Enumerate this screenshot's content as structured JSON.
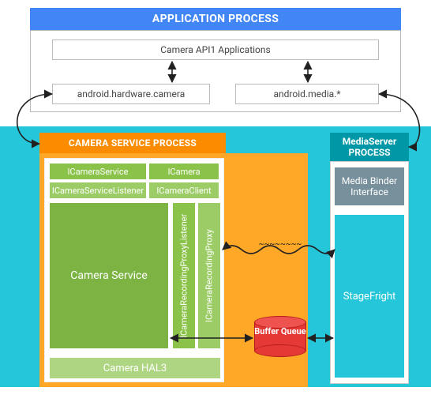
{
  "app": {
    "header": "APPLICATION PROCESS",
    "api": "Camera API1 Applications",
    "hal_camera": "android.hardware.camera",
    "media_ns": "android.media.*"
  },
  "csp": {
    "header": "CAMERA SERVICE PROCESS",
    "svc_iface": "ICameraService",
    "cam_iface": "ICamera",
    "svc_listener": "ICameraServiceListener",
    "cam_client": "ICameraClient",
    "rec_proxy_listener": "ICameraRecordingProxyListener",
    "rec_proxy": "ICameraRecordingProxy",
    "service": "Camera Service",
    "hal3": "Camera HAL3"
  },
  "msp": {
    "header": "MediaServer PROCESS",
    "binder": "Media Binder Interface",
    "stagefright": "StageFright"
  },
  "bufq": "Buffer Queue",
  "chart_data": {
    "type": "diagram",
    "title": "Android Camera Architecture (API1 path)",
    "nodes": [
      {
        "id": "app_process",
        "label": "APPLICATION PROCESS",
        "children": [
          "api1",
          "hw_camera",
          "media_ns"
        ]
      },
      {
        "id": "api1",
        "label": "Camera API1 Applications"
      },
      {
        "id": "hw_camera",
        "label": "android.hardware.camera"
      },
      {
        "id": "media_ns",
        "label": "android.media.*"
      },
      {
        "id": "camera_service_process",
        "label": "CAMERA SERVICE PROCESS",
        "children": [
          "ICameraService",
          "ICamera",
          "ICameraServiceListener",
          "ICameraClient",
          "ICameraRecordingProxyListener",
          "ICameraRecordingProxy",
          "CameraService",
          "CameraHAL3"
        ]
      },
      {
        "id": "ICameraService",
        "label": "ICameraService"
      },
      {
        "id": "ICamera",
        "label": "ICamera"
      },
      {
        "id": "ICameraServiceListener",
        "label": "ICameraServiceListener"
      },
      {
        "id": "ICameraClient",
        "label": "ICameraClient"
      },
      {
        "id": "ICameraRecordingProxyListener",
        "label": "ICameraRecordingProxyListener"
      },
      {
        "id": "ICameraRecordingProxy",
        "label": "ICameraRecordingProxy"
      },
      {
        "id": "CameraService",
        "label": "Camera Service"
      },
      {
        "id": "CameraHAL3",
        "label": "Camera HAL3"
      },
      {
        "id": "mediaserver_process",
        "label": "MediaServer PROCESS",
        "children": [
          "MediaBinder",
          "StageFright"
        ]
      },
      {
        "id": "MediaBinder",
        "label": "Media Binder Interface"
      },
      {
        "id": "StageFright",
        "label": "StageFright"
      },
      {
        "id": "BufferQueue",
        "label": "Buffer Queue"
      }
    ],
    "edges": [
      {
        "from": "api1",
        "to": "hw_camera",
        "dir": "both"
      },
      {
        "from": "api1",
        "to": "media_ns",
        "dir": "both"
      },
      {
        "from": "hw_camera",
        "to": "camera_service_process",
        "dir": "both"
      },
      {
        "from": "media_ns",
        "to": "mediaserver_process",
        "dir": "both"
      },
      {
        "from": "ICameraRecordingProxy",
        "to": "StageFright",
        "dir": "both",
        "style": "wavy"
      },
      {
        "from": "CameraService",
        "to": "BufferQueue",
        "dir": "both"
      },
      {
        "from": "BufferQueue",
        "to": "StageFright",
        "dir": "both"
      }
    ]
  }
}
